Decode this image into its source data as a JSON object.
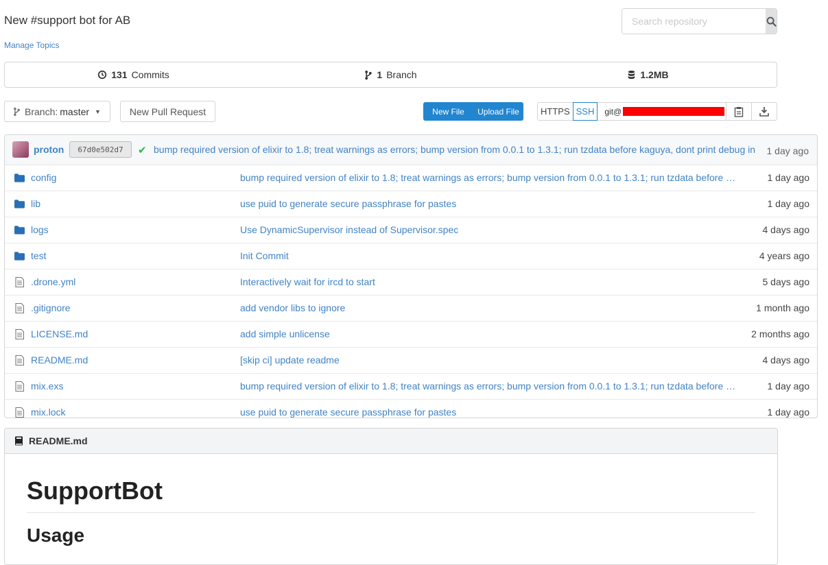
{
  "repo": {
    "description": "New #support bot for AB",
    "manage_topics": "Manage Topics"
  },
  "search": {
    "placeholder": "Search repository"
  },
  "stats": {
    "commits_count": "131",
    "commits_label": "Commits",
    "branches_count": "1",
    "branches_label": "Branch",
    "size": "1.2MB"
  },
  "toolbar": {
    "branch_prefix": "Branch:",
    "branch_name": "master",
    "new_pull_request": "New Pull Request",
    "new_file": "New File",
    "upload_file": "Upload File"
  },
  "clone": {
    "https": "HTTPS",
    "ssh": "SSH",
    "url_prefix": "git@"
  },
  "latest_commit": {
    "author": "proton",
    "sha": "67d0e502d7",
    "message": "bump required version of elixir to 1.8; treat warnings as errors; bump version from 0.0.1 to 1.3.1; run tzdata before kaguya, dont print debug in CI",
    "age": "1 day ago"
  },
  "files": [
    {
      "name": "config",
      "type": "folder",
      "message": "bump required version of elixir to 1.8; treat warnings as errors; bump version from 0.0.1 to 1.3.1; run tzdata before kaguya, dont print debug in CI",
      "age": "1 day ago"
    },
    {
      "name": "lib",
      "type": "folder",
      "message": "use puid to generate secure passphrase for pastes",
      "age": "1 day ago"
    },
    {
      "name": "logs",
      "type": "folder",
      "message": "Use DynamicSupervisor instead of Supervisor.spec",
      "age": "4 days ago"
    },
    {
      "name": "test",
      "type": "folder",
      "message": "Init Commit",
      "age": "4 years ago"
    },
    {
      "name": ".drone.yml",
      "type": "file",
      "message": "Interactively wait for ircd to start",
      "age": "5 days ago"
    },
    {
      "name": ".gitignore",
      "type": "file",
      "message": "add vendor libs to ignore",
      "age": "1 month ago"
    },
    {
      "name": "LICENSE.md",
      "type": "file",
      "message": "add simple unlicense",
      "age": "2 months ago"
    },
    {
      "name": "README.md",
      "type": "file",
      "message": "[skip ci] update readme",
      "age": "4 days ago"
    },
    {
      "name": "mix.exs",
      "type": "file",
      "message": "bump required version of elixir to 1.8; treat warnings as errors; bump version from 0.0.1 to 1.3.1; run tzdata before kaguya, dont print debug in CI",
      "age": "1 day ago"
    },
    {
      "name": "mix.lock",
      "type": "file",
      "message": "use puid to generate secure passphrase for pastes",
      "age": "1 day ago"
    }
  ],
  "readme": {
    "filename": "README.md",
    "h1": "SupportBot",
    "h2": "Usage"
  },
  "colors": {
    "link": "#4183c4",
    "primary": "#2185d0",
    "success": "#21ba45",
    "redaction": "#ff0000"
  }
}
